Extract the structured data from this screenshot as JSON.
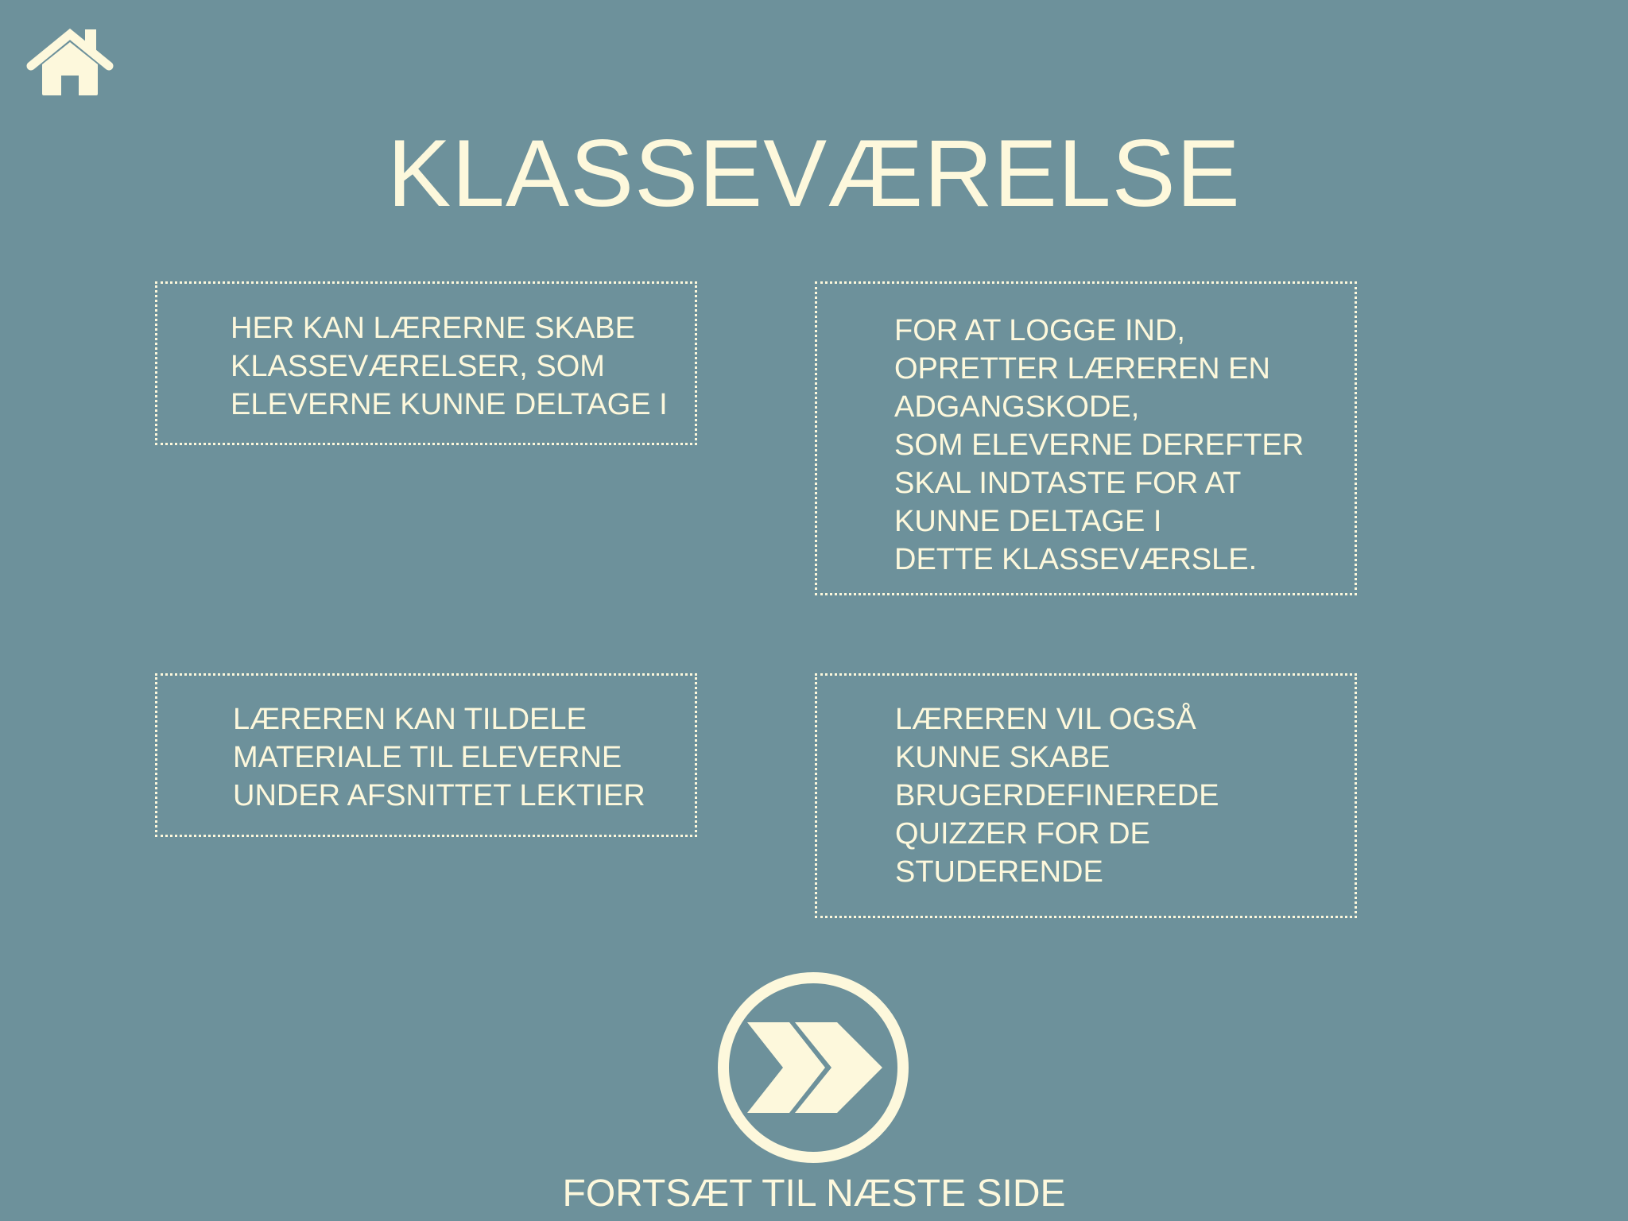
{
  "icons": {
    "home": "home-icon",
    "next": "double-chevron-right-icon"
  },
  "colors": {
    "background": "#6d919b",
    "foreground": "#fdf8dc"
  },
  "title": "KLASSEVÆRELSE",
  "boxes": [
    {
      "text": "HER KAN LÆRERNE SKABE\nKLASSEVÆRELSER, SOM\nELEVERNE KUNNE DELTAGE I"
    },
    {
      "text": "FOR AT LOGGE IND,\nOPRETTER LÆREREN EN\nADGANGSKODE,\nSOM ELEVERNE DEREFTER\nSKAL INDTASTE FOR AT\nKUNNE DELTAGE I\nDETTE KLASSEVÆRSLE."
    },
    {
      "text": "LÆREREN KAN TILDELE\nMATERIALE TIL ELEVERNE\nUNDER AFSNITTET LEKTIER"
    },
    {
      "text": "LÆREREN VIL OGSÅ\nKUNNE SKABE\nBRUGERDEFINEREDE\nQUIZZER FOR DE\nSTUDERENDE"
    }
  ],
  "next": {
    "label": "FORTSÆT TIL NÆSTE SIDE"
  }
}
